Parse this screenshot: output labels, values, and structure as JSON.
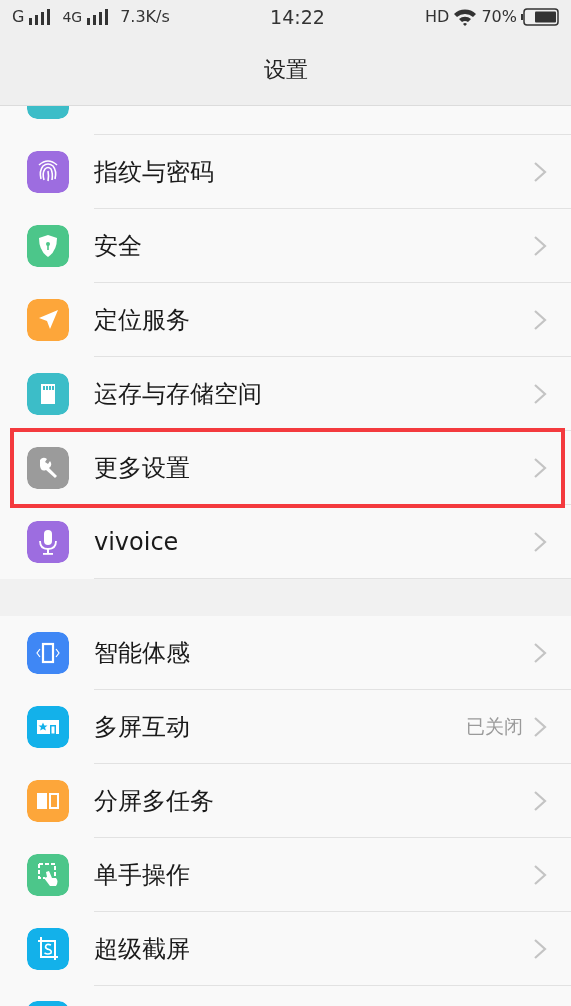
{
  "status_bar": {
    "carrier_1": "G",
    "carrier_2": "4G",
    "speed": "7.3K/s",
    "time": "14:22",
    "hd": "HD",
    "battery": "70%"
  },
  "title": "设置",
  "groups": [
    {
      "rows": [
        {
          "kind": "partial",
          "color": "#3cbdc8"
        },
        {
          "kind": "item",
          "label": "指纹与密码",
          "color": "#9d6de0",
          "highlighted": false
        },
        {
          "kind": "item",
          "label": "安全",
          "color": "#4cc68a",
          "highlighted": false
        },
        {
          "kind": "item",
          "label": "定位服务",
          "color": "#fda63a",
          "highlighted": false
        },
        {
          "kind": "item",
          "label": "运存与存储空间",
          "color": "#3cbdc8",
          "highlighted": false
        },
        {
          "kind": "item",
          "label": "更多设置",
          "color": "#9b9b9b",
          "highlighted": true
        },
        {
          "kind": "item",
          "label": "vivoice",
          "color": "#9d6de0",
          "highlighted": false
        }
      ]
    },
    {
      "rows": [
        {
          "kind": "item",
          "label": "智能体感",
          "color": "#3f87f5",
          "highlighted": false
        },
        {
          "kind": "item",
          "label": "多屏互动",
          "value": "已关闭",
          "color": "#13b1ea",
          "highlighted": false
        },
        {
          "kind": "item",
          "label": "分屏多任务",
          "color": "#fda63a",
          "highlighted": false
        },
        {
          "kind": "item",
          "label": "单手操作",
          "color": "#4cc68a",
          "highlighted": false
        },
        {
          "kind": "item",
          "label": "超级截屏",
          "color": "#13b1ea",
          "highlighted": false
        },
        {
          "kind": "partial",
          "color": "#13b1ea"
        }
      ]
    }
  ]
}
